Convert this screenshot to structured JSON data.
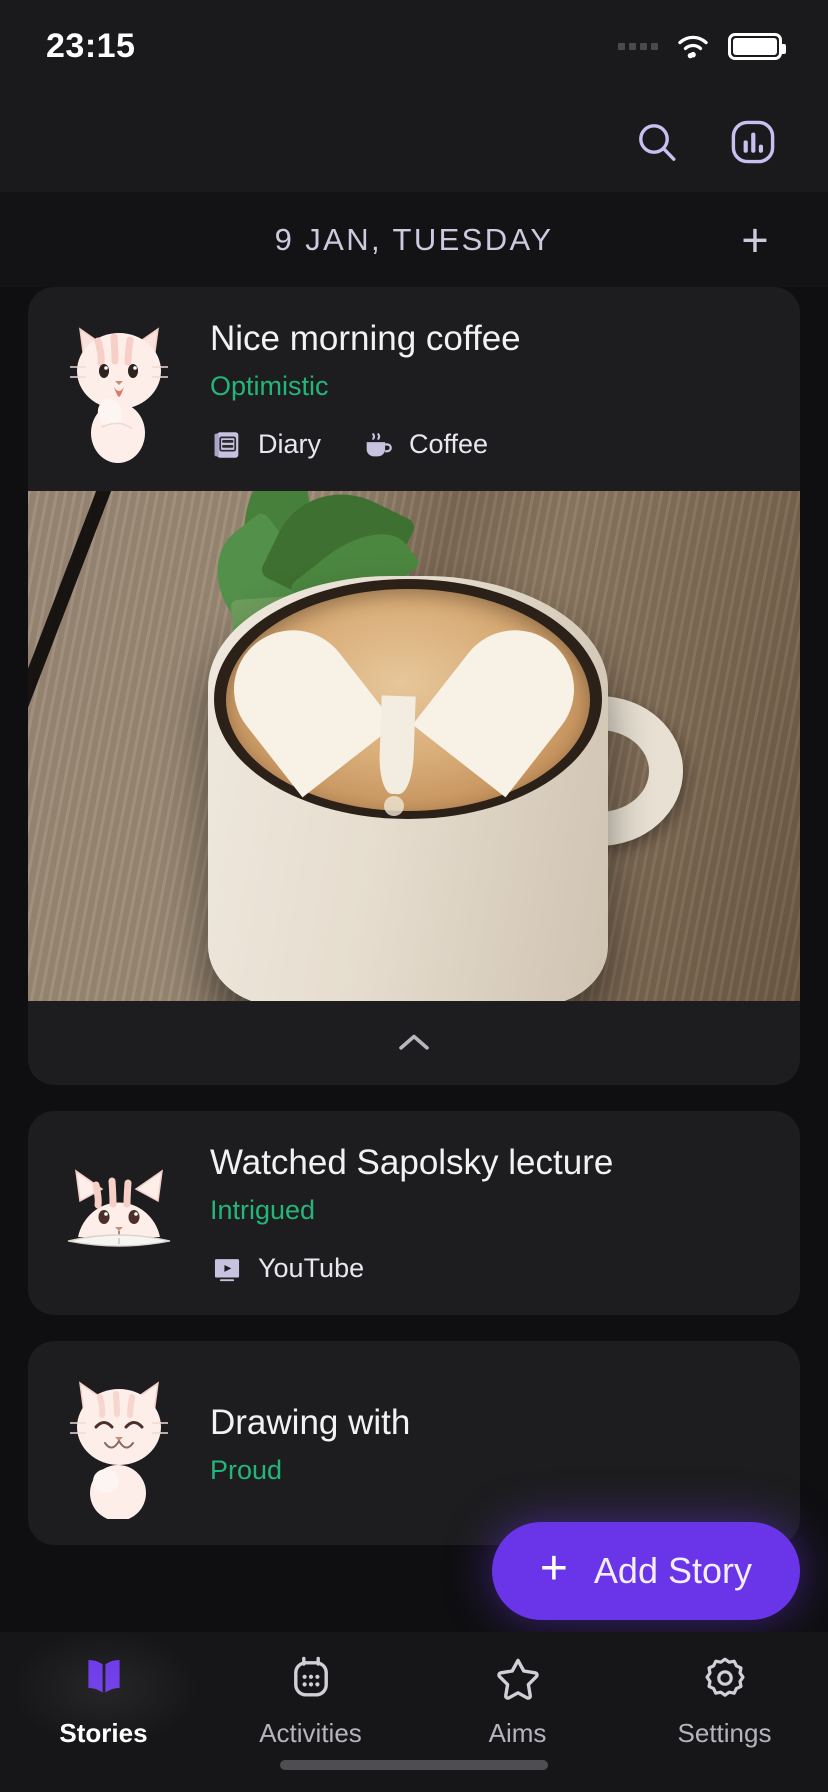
{
  "status_bar": {
    "time": "23:15",
    "signal_icon": "signal-dots-icon",
    "wifi_icon": "wifi-icon",
    "battery_icon": "battery-full-icon"
  },
  "top_bar": {
    "search_icon": "search-icon",
    "stats_icon": "bar-chart-icon"
  },
  "date_header": {
    "label": "9 JAN, TUESDAY",
    "add_label": "+"
  },
  "theme": {
    "background": "#0f0f11",
    "card": "#1d1d1f",
    "accent": "#6a35e8",
    "mood_green": "#23b579",
    "lavender": "#cfc9de"
  },
  "stories": [
    {
      "title": "Nice morning coffee",
      "mood": "Optimistic",
      "avatar_icon": "cat-excited-icon",
      "tags": [
        {
          "label": "Diary",
          "icon": "notebook-icon"
        },
        {
          "label": "Coffee",
          "icon": "coffee-cup-icon"
        }
      ],
      "has_photo": true,
      "photo_alt": "Latte with heart shaped foam art in a tall ceramic mug on a wooden table",
      "collapse_icon": "chevron-up-icon"
    },
    {
      "title": "Watched Sapolsky lecture",
      "mood": "Intrigued",
      "avatar_icon": "cat-reading-icon",
      "tags": [
        {
          "label": "YouTube",
          "icon": "youtube-play-icon"
        }
      ],
      "has_photo": false
    },
    {
      "title": "Drawing with",
      "mood": "Proud",
      "avatar_icon": "cat-happy-icon",
      "tags": [],
      "has_photo": false
    }
  ],
  "fab": {
    "plus": "+",
    "label": "Add Story"
  },
  "bottom_nav": {
    "items": [
      {
        "label": "Stories",
        "icon": "open-book-icon",
        "active": true
      },
      {
        "label": "Activities",
        "icon": "calendar-dots-icon",
        "active": false
      },
      {
        "label": "Aims",
        "icon": "star-icon",
        "active": false
      },
      {
        "label": "Settings",
        "icon": "gear-icon",
        "active": false
      }
    ]
  }
}
